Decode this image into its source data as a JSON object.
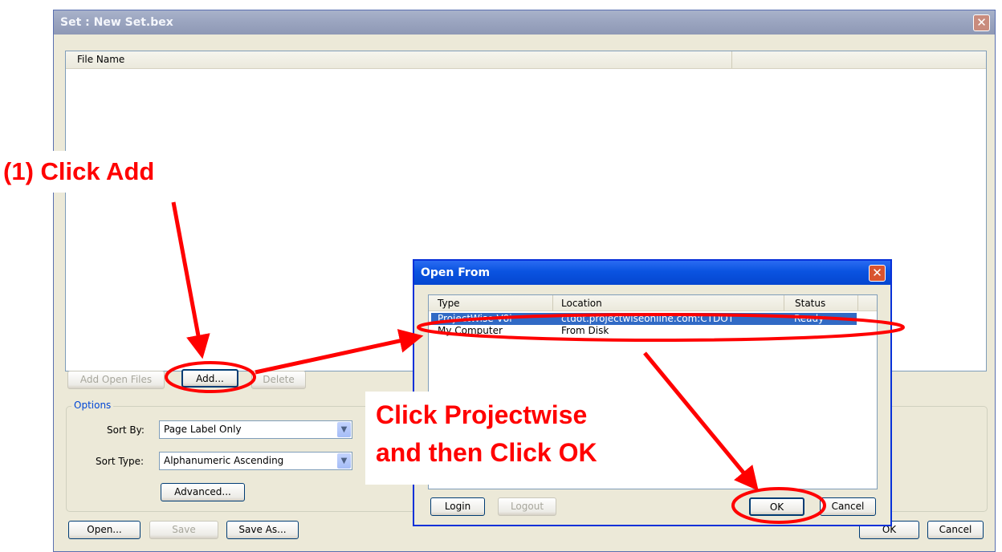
{
  "main_window": {
    "title": "Set : New Set.bex",
    "columns": [
      "File Name",
      ""
    ],
    "buttons": {
      "add_open_files": "Add Open Files",
      "add": "Add...",
      "delete": "Delete",
      "open": "Open...",
      "save": "Save",
      "save_as": "Save As...",
      "ok": "OK",
      "cancel": "Cancel",
      "advanced": "Advanced..."
    },
    "options": {
      "title": "Options",
      "sort_by_label": "Sort By:",
      "sort_by_value": "Page Label Only",
      "sort_type_label": "Sort Type:",
      "sort_type_value": "Alphanumeric Ascending"
    }
  },
  "open_from_dialog": {
    "title": "Open From",
    "columns": [
      "Type",
      "Location",
      "Status"
    ],
    "rows": [
      {
        "type": "ProjectWise V8i",
        "location": "ctdot.projectwiseonline.com:CTDOT",
        "status": "Ready",
        "selected": true
      },
      {
        "type": "My Computer",
        "location": "From Disk",
        "status": "",
        "selected": false
      }
    ],
    "buttons": {
      "login": "Login",
      "logout": "Logout",
      "ok": "OK",
      "cancel": "Cancel"
    }
  },
  "annotations": {
    "step1": "(1) Click Add",
    "step2_line1": "Click Projectwise",
    "step2_line2": "and then Click OK"
  },
  "colors": {
    "annotation": "#ff0000",
    "selection": "#316ac5",
    "xp_title_active": "#0a53e0",
    "xp_title_inactive": "#9aa4bf"
  }
}
